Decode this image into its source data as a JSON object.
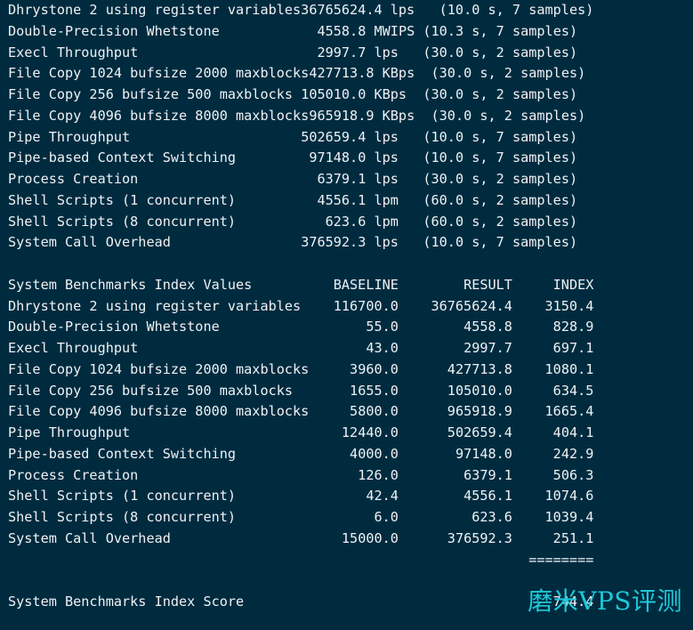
{
  "raw_results": [
    {
      "name": "Dhrystone 2 using register variables",
      "value": "36765624.4",
      "unit": "lps",
      "detail": "(10.0 s, 7 samples)"
    },
    {
      "name": "Double-Precision Whetstone",
      "value": "4558.8",
      "unit": "MWIPS",
      "detail": "(10.3 s, 7 samples)"
    },
    {
      "name": "Execl Throughput",
      "value": "2997.7",
      "unit": "lps",
      "detail": "(30.0 s, 2 samples)"
    },
    {
      "name": "File Copy 1024 bufsize 2000 maxblocks",
      "value": "427713.8",
      "unit": "KBps",
      "detail": "(30.0 s, 2 samples)"
    },
    {
      "name": "File Copy 256 bufsize 500 maxblocks",
      "value": "105010.0",
      "unit": "KBps",
      "detail": "(30.0 s, 2 samples)"
    },
    {
      "name": "File Copy 4096 bufsize 8000 maxblocks",
      "value": "965918.9",
      "unit": "KBps",
      "detail": "(30.0 s, 2 samples)"
    },
    {
      "name": "Pipe Throughput",
      "value": "502659.4",
      "unit": "lps",
      "detail": "(10.0 s, 7 samples)"
    },
    {
      "name": "Pipe-based Context Switching",
      "value": "97148.0",
      "unit": "lps",
      "detail": "(10.0 s, 7 samples)"
    },
    {
      "name": "Process Creation",
      "value": "6379.1",
      "unit": "lps",
      "detail": "(30.0 s, 2 samples)"
    },
    {
      "name": "Shell Scripts (1 concurrent)",
      "value": "4556.1",
      "unit": "lpm",
      "detail": "(60.0 s, 2 samples)"
    },
    {
      "name": "Shell Scripts (8 concurrent)",
      "value": "623.6",
      "unit": "lpm",
      "detail": "(60.0 s, 2 samples)"
    },
    {
      "name": "System Call Overhead",
      "value": "376592.3",
      "unit": "lps",
      "detail": "(10.0 s, 7 samples)"
    }
  ],
  "index_header": {
    "title": "System Benchmarks Index Values",
    "baseline": "BASELINE",
    "result": "RESULT",
    "index": "INDEX"
  },
  "index_rows": [
    {
      "name": "Dhrystone 2 using register variables",
      "baseline": "116700.0",
      "result": "36765624.4",
      "index": "3150.4"
    },
    {
      "name": "Double-Precision Whetstone",
      "baseline": "55.0",
      "result": "4558.8",
      "index": "828.9"
    },
    {
      "name": "Execl Throughput",
      "baseline": "43.0",
      "result": "2997.7",
      "index": "697.1"
    },
    {
      "name": "File Copy 1024 bufsize 2000 maxblocks",
      "baseline": "3960.0",
      "result": "427713.8",
      "index": "1080.1"
    },
    {
      "name": "File Copy 256 bufsize 500 maxblocks",
      "baseline": "1655.0",
      "result": "105010.0",
      "index": "634.5"
    },
    {
      "name": "File Copy 4096 bufsize 8000 maxblocks",
      "baseline": "5800.0",
      "result": "965918.9",
      "index": "1665.4"
    },
    {
      "name": "Pipe Throughput",
      "baseline": "12440.0",
      "result": "502659.4",
      "index": "404.1"
    },
    {
      "name": "Pipe-based Context Switching",
      "baseline": "4000.0",
      "result": "97148.0",
      "index": "242.9"
    },
    {
      "name": "Process Creation",
      "baseline": "126.0",
      "result": "6379.1",
      "index": "506.3"
    },
    {
      "name": "Shell Scripts (1 concurrent)",
      "baseline": "42.4",
      "result": "4556.1",
      "index": "1074.6"
    },
    {
      "name": "Shell Scripts (8 concurrent)",
      "baseline": "6.0",
      "result": "623.6",
      "index": "1039.4"
    },
    {
      "name": "System Call Overhead",
      "baseline": "15000.0",
      "result": "376592.3",
      "index": "251.1"
    }
  ],
  "separator": "========",
  "score": {
    "label": "System Benchmarks Index Score",
    "value": "744.4"
  },
  "watermark": "磨米VPS评测",
  "colors": {
    "background": "#002b3f",
    "text": "#eef2f4",
    "watermark": "#1ec8d8"
  }
}
